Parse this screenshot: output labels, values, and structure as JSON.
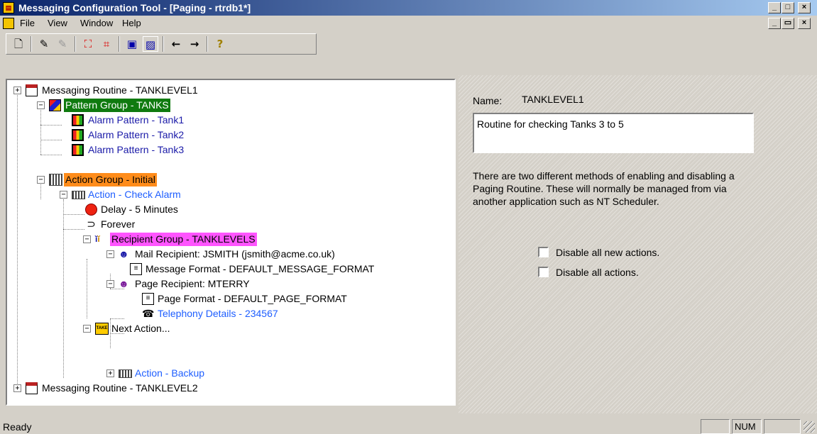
{
  "window": {
    "title": "Messaging Configuration Tool - [Paging - rtrdb1*]"
  },
  "menu": {
    "items": [
      "File",
      "View",
      "Window",
      "Help"
    ]
  },
  "tree": {
    "nodes": [
      {
        "label": "Messaging Routine - TANKLEVEL1",
        "expander": "+",
        "icon": "calendar-icon"
      },
      {
        "label": "Pattern Group - TANKS",
        "expander": "−",
        "icon": "cubes-icon",
        "highlight": "#0f7a0f"
      },
      {
        "label": "Alarm Pattern - Tank1",
        "icon": "pattern-icon"
      },
      {
        "label": "Alarm Pattern - Tank2",
        "icon": "pattern-icon"
      },
      {
        "label": "Alarm Pattern - Tank3",
        "icon": "pattern-icon"
      },
      {
        "label": "Action Group - Initial",
        "expander": "−",
        "icon": "action-group-icon",
        "highlight": "#ff8c1a"
      },
      {
        "label": "Action - Check Alarm",
        "expander": "−",
        "icon": "action-icon"
      },
      {
        "label": "Delay - 5 Minutes",
        "icon": "clock-icon"
      },
      {
        "label": "Forever",
        "icon": "forever-icon"
      },
      {
        "label": "Recipient Group - TANKLEVELS",
        "expander": "−",
        "icon": "people-icon",
        "highlight": "#ff55ff"
      },
      {
        "label": "Mail Recipient: JSMITH (jsmith@acme.co.uk)",
        "expander": "−",
        "icon": "person-icon"
      },
      {
        "label": "Message Format - DEFAULT_MESSAGE_FORMAT",
        "icon": "format-icon"
      },
      {
        "label": "Page Recipient: MTERRY",
        "expander": "−",
        "icon": "person-pager-icon"
      },
      {
        "label": "Page Format - DEFAULT_PAGE_FORMAT",
        "icon": "format-icon"
      },
      {
        "label": "Telephony Details - 234567",
        "icon": "telephone-icon"
      },
      {
        "label": "Next Action...",
        "expander": "−",
        "icon": "take-icon"
      },
      {
        "label": "Action - Backup",
        "expander": "+",
        "icon": "action-icon"
      },
      {
        "label": "Messaging Routine - TANKLEVEL2",
        "expander": "+",
        "icon": "calendar-icon"
      }
    ]
  },
  "details": {
    "name_label": "Name:",
    "name_value": "TANKLEVEL1",
    "description": "Routine for checking Tanks 3 to 5",
    "info": "There are two different methods of enabling and disabling a Paging Routine. These will normally be managed from via another application such as NT Scheduler.",
    "checkboxes": [
      {
        "label": "Disable all new actions.",
        "checked": false
      },
      {
        "label": "Disable all actions.",
        "checked": false
      }
    ]
  },
  "status": {
    "text": "Ready",
    "num": "NUM"
  }
}
